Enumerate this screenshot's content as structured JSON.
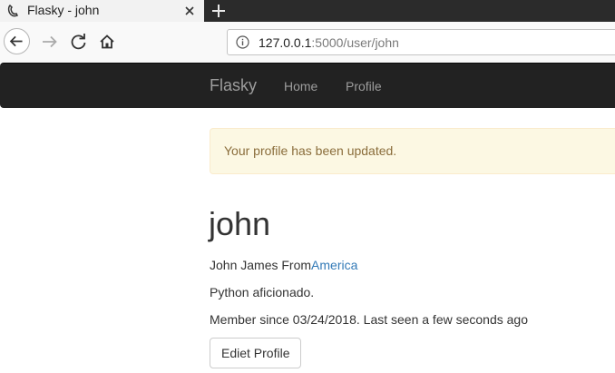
{
  "browser": {
    "tab": {
      "title": "Flasky - john"
    },
    "url": {
      "host": "127.0.0.1",
      "rest": ":5000/user/john"
    }
  },
  "site": {
    "brand": "Flasky",
    "nav": {
      "home": "Home",
      "profile": "Profile"
    }
  },
  "flash": {
    "message": "Your profile has been updated."
  },
  "profile": {
    "username": "john",
    "name_from": "John James From",
    "location": "America",
    "about": "Python aficionado.",
    "member_since": "Member since 03/24/2018. Last seen a few seconds ago",
    "edit_button": "Ediet Profile"
  },
  "colors": {
    "navbar_bg": "#222222",
    "nav_text": "#9d9d9d",
    "alert_bg": "#fcf8e3",
    "alert_text": "#8a6d3b",
    "link": "#337ab7"
  },
  "icons": [
    "tab-favicon-icon",
    "close-icon",
    "plus-icon",
    "back-arrow-icon",
    "forward-arrow-icon",
    "reload-icon",
    "home-icon",
    "info-icon"
  ]
}
